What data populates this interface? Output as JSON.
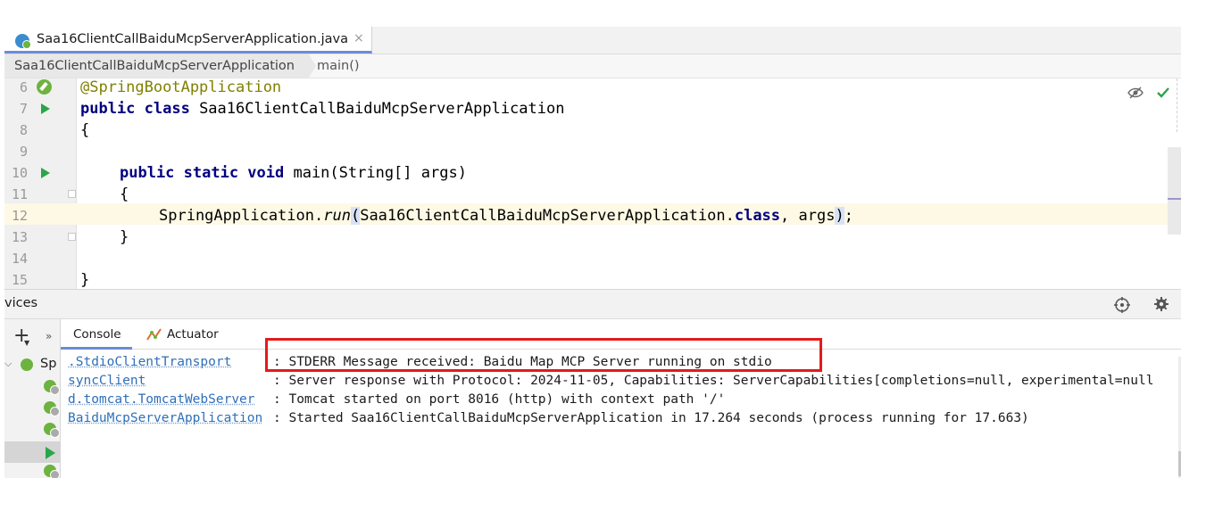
{
  "tab": {
    "filename": "Saa16ClientCallBaiduMcpServerApplication.java",
    "close": "×"
  },
  "breadcrumb": {
    "class_name": "Saa16ClientCallBaiduMcpServerApplication",
    "method": "main()"
  },
  "editor": {
    "lines": [
      {
        "num": "6",
        "gutter_icon": "spring-bean-icon",
        "text": "@SpringBootApplication"
      },
      {
        "num": "7",
        "gutter_icon": "run-icon",
        "kw": "public class",
        "text": " Saa16ClientCallBaiduMcpServerApplication"
      },
      {
        "num": "8",
        "text": "{"
      },
      {
        "num": "9",
        "text": ""
      },
      {
        "num": "10",
        "gutter_icon": "run-icon",
        "kw1": "public static void",
        "text": " main(String[] args)"
      },
      {
        "num": "11",
        "text": "{"
      },
      {
        "num": "12",
        "pre": "SpringApplication.",
        "call": "run",
        "open": "(",
        "mid": "Saa16ClientCallBaiduMcpServerApplication.",
        "kw": "class",
        "post": ", args",
        "close": ")",
        "end": ";"
      },
      {
        "num": "13",
        "text": "}"
      },
      {
        "num": "14",
        "text": ""
      },
      {
        "num": "15",
        "text": "}"
      }
    ],
    "current_line": "12"
  },
  "services": {
    "title": "vices",
    "toolbar": {
      "add": "+",
      "expand": "»"
    },
    "tree_root_label": "Sp",
    "icons": [
      "target-icon",
      "gear-icon"
    ]
  },
  "console": {
    "tabs": [
      {
        "label": "Console",
        "active": true
      },
      {
        "label": "Actuator",
        "active": false
      }
    ],
    "rows": [
      {
        "logger": ".StdioClientTransport",
        "message": ": STDERR Message received: Baidu Map MCP Server running on stdio"
      },
      {
        "logger": "syncClient",
        "message": ": Server response with Protocol: 2024-11-05, Capabilities: ServerCapabilities[completions=null, experimental=null"
      },
      {
        "logger": "d.tomcat.TomcatWebServer",
        "message": ": Tomcat started on port 8016 (http) with context path '/'"
      },
      {
        "logger": "BaiduMcpServerApplication",
        "message": ": Started Saa16ClientCallBaiduMcpServerApplication in 17.264 seconds (process running for 17.663)"
      }
    ]
  },
  "colors": {
    "keyword": "#000080",
    "annotation": "#808000",
    "run_green": "#2aa64a",
    "spring_green": "#6db33f",
    "link_blue": "#2f6fb8",
    "highlight_box": "#e31b1b",
    "current_line_bg": "#fdf9e5"
  }
}
